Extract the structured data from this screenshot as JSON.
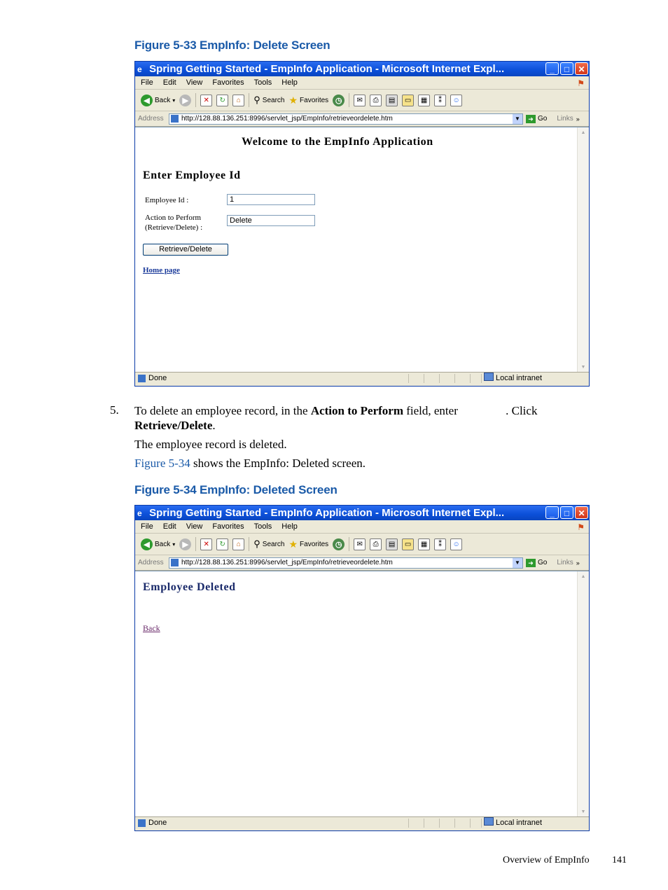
{
  "figure33": {
    "caption": "Figure 5-33 EmpInfo: Delete Screen",
    "window": {
      "title": "Spring Getting Started - EmpInfo Application - Microsoft Internet Expl...",
      "menu": [
        "File",
        "Edit",
        "View",
        "Favorites",
        "Tools",
        "Help"
      ],
      "toolbar": {
        "back": "Back",
        "search": "Search",
        "favorites": "Favorites"
      },
      "address_label": "Address",
      "url": "http://128.88.136.251:8996/servlet_jsp/EmpInfo/retrieveordelete.htm",
      "go": "Go",
      "links": "Links",
      "status": "Done",
      "zone": "Local intranet"
    },
    "page": {
      "heading": "Welcome to the EmpInfo Application",
      "subheading": "Enter Employee Id",
      "employee_id_label": "Employee Id :",
      "employee_id_value": "1",
      "action_label_line1": "Action to Perform",
      "action_label_line2": "(Retrieve/Delete) :",
      "action_value": "Delete",
      "submit_label": "Retrieve/Delete",
      "home_link": "Home page"
    }
  },
  "step5": {
    "number": "5.",
    "text_a": "To delete an employee record, in the ",
    "bold_a": "Action to Perform",
    "text_b": " field, enter ",
    "text_c": ". Click",
    "bold_b": "Retrieve/Delete",
    "text_d": ".",
    "result": "The employee record is deleted.",
    "ref_link": "Figure 5-34",
    "ref_rest": " shows the EmpInfo: Deleted screen."
  },
  "figure34": {
    "caption": "Figure 5-34 EmpInfo: Deleted Screen",
    "window": {
      "title": "Spring Getting Started - EmpInfo Application - Microsoft Internet Expl...",
      "menu": [
        "File",
        "Edit",
        "View",
        "Favorites",
        "Tools",
        "Help"
      ],
      "toolbar": {
        "back": "Back",
        "search": "Search",
        "favorites": "Favorites"
      },
      "address_label": "Address",
      "url": "http://128.88.136.251:8996/servlet_jsp/EmpInfo/retrieveordelete.htm",
      "go": "Go",
      "links": "Links",
      "status": "Done",
      "zone": "Local intranet"
    },
    "page": {
      "heading": "Employee Deleted",
      "back_link": "Back"
    }
  },
  "footer": {
    "section": "Overview of EmpInfo",
    "page": "141"
  }
}
